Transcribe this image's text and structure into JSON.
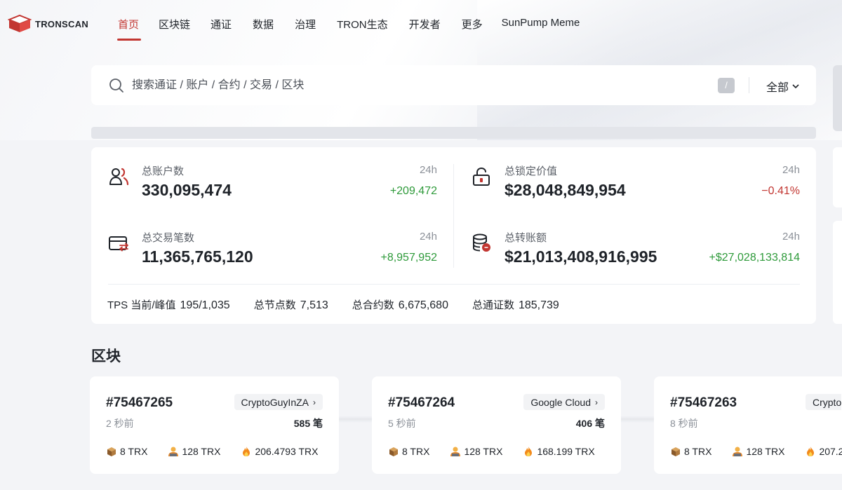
{
  "brand": {
    "name": "TRONSCAN",
    "accent": "#c23631"
  },
  "nav": {
    "items": [
      {
        "label": "首页",
        "active": true
      },
      {
        "label": "区块链",
        "active": false
      },
      {
        "label": "通证",
        "active": false
      },
      {
        "label": "数据",
        "active": false
      },
      {
        "label": "治理",
        "active": false
      },
      {
        "label": "TRON生态",
        "active": false
      },
      {
        "label": "开发者",
        "active": false
      },
      {
        "label": "更多",
        "active": false
      },
      {
        "label": "SunPump Meme",
        "active": false
      }
    ]
  },
  "search": {
    "placeholder": "搜索通证 / 账户 / 合约 / 交易 / 区块",
    "value": "",
    "shortcut": "/",
    "filter_label": "全部",
    "icon": "search-icon"
  },
  "stats": {
    "total_accounts": {
      "label": "总账户数",
      "value": "330,095,474",
      "period": "24h",
      "delta": "+209,472",
      "trend": "up",
      "icon": "users-icon"
    },
    "total_locked": {
      "label": "总锁定价值",
      "value": "$28,048,849,954",
      "period": "24h",
      "delta": "−0.41%",
      "trend": "down",
      "icon": "unlock-icon"
    },
    "total_transactions": {
      "label": "总交易笔数",
      "value": "11,365,765,120",
      "period": "24h",
      "delta": "+8,957,952",
      "trend": "up",
      "icon": "card-transfer-icon"
    },
    "total_transfer": {
      "label": "总转账额",
      "value": "$21,013,408,916,995",
      "period": "24h",
      "delta": "+$27,028,133,814",
      "trend": "up",
      "icon": "coin-stack-icon"
    }
  },
  "metrics": [
    {
      "label": "TPS 当前/峰值",
      "value": "195/1,035"
    },
    {
      "label": "总节点数",
      "value": "7,513"
    },
    {
      "label": "总合约数",
      "value": "6,675,680"
    },
    {
      "label": "总通证数",
      "value": "185,739"
    }
  ],
  "blocks_section": {
    "title": "区块"
  },
  "blocks": [
    {
      "number": "#75467265",
      "producer": "CryptoGuyInZA",
      "time": "2 秒前",
      "tx_count": "585 笔",
      "rewards": [
        "8 TRX",
        "128 TRX",
        "206.4793 TRX"
      ]
    },
    {
      "number": "#75467264",
      "producer": "Google Cloud",
      "time": "5 秒前",
      "tx_count": "406 笔",
      "rewards": [
        "8 TRX",
        "128 TRX",
        "168.199 TRX"
      ]
    },
    {
      "number": "#75467263",
      "producer": "Crypto",
      "time": "8 秒前",
      "tx_count": "",
      "rewards": [
        "8 TRX",
        "128 TRX",
        "207.2"
      ]
    }
  ],
  "colors": {
    "up": "#2e9a3a",
    "down": "#c23631",
    "background": "#f3f4f7"
  }
}
